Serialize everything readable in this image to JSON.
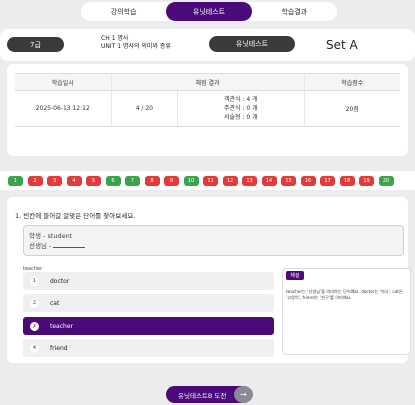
{
  "tabs": [
    {
      "label": "강의학습",
      "active": false
    },
    {
      "label": "유닛테스트",
      "active": true
    },
    {
      "label": "학습결과",
      "active": false
    }
  ],
  "header": {
    "grade": "7급",
    "chapter": "CH 1 명사",
    "unit": "UNIT 1 명사의 의미와 종류",
    "test_button": "유닛테스트",
    "set": "Set A"
  },
  "result": {
    "headers": [
      "학습일시",
      "채점 결과",
      "학습점수"
    ],
    "date": "2025-06-13 12:12",
    "correct": "4 / 20",
    "objective": "객관식 : 4 개",
    "subjective": "주관식 : 0 개",
    "descriptive": "서술형 : 0 개",
    "score": "20점"
  },
  "questions": [
    {
      "n": "1",
      "status": "ok"
    },
    {
      "n": "2",
      "status": "ng"
    },
    {
      "n": "3",
      "status": "ng"
    },
    {
      "n": "4",
      "status": "ng"
    },
    {
      "n": "5",
      "status": "ng"
    },
    {
      "n": "6",
      "status": "ok"
    },
    {
      "n": "7",
      "status": "ok"
    },
    {
      "n": "8",
      "status": "ng"
    },
    {
      "n": "9",
      "status": "ng"
    },
    {
      "n": "10",
      "status": "ok"
    },
    {
      "n": "11",
      "status": "ng"
    },
    {
      "n": "12",
      "status": "ng"
    },
    {
      "n": "13",
      "status": "ng"
    },
    {
      "n": "14",
      "status": "ng"
    },
    {
      "n": "15",
      "status": "ng"
    },
    {
      "n": "16",
      "status": "ng"
    },
    {
      "n": "17",
      "status": "ng"
    },
    {
      "n": "18",
      "status": "ng"
    },
    {
      "n": "19",
      "status": "ng"
    },
    {
      "n": "20",
      "status": "ok"
    }
  ],
  "question": {
    "title": "1.  빈칸에 들어갈 알맞은 단어를 찾아보세요.",
    "line1": "학생 - student",
    "line2": "선생님 - ",
    "word_label": "teacher",
    "options": [
      {
        "num": "1",
        "text": "doctor",
        "selected": false
      },
      {
        "num": "2",
        "text": "cat",
        "selected": false
      },
      {
        "num": "✗",
        "text": "teacher",
        "selected": true
      },
      {
        "num": "4",
        "text": "friend",
        "selected": false
      }
    ],
    "explain_badge": "해설",
    "explain_text": "teacher는 '선생님'을 의미하는 단어예요. doctor는 '의사', cat은 '고양이', friend는 '친구'를 의미해요."
  },
  "cta": {
    "label": "유닛테스트B 도전",
    "arrow": "→"
  },
  "colors": {
    "accent": "#4b0a7a",
    "correct": "#3da34a",
    "wrong": "#e33a3a"
  }
}
